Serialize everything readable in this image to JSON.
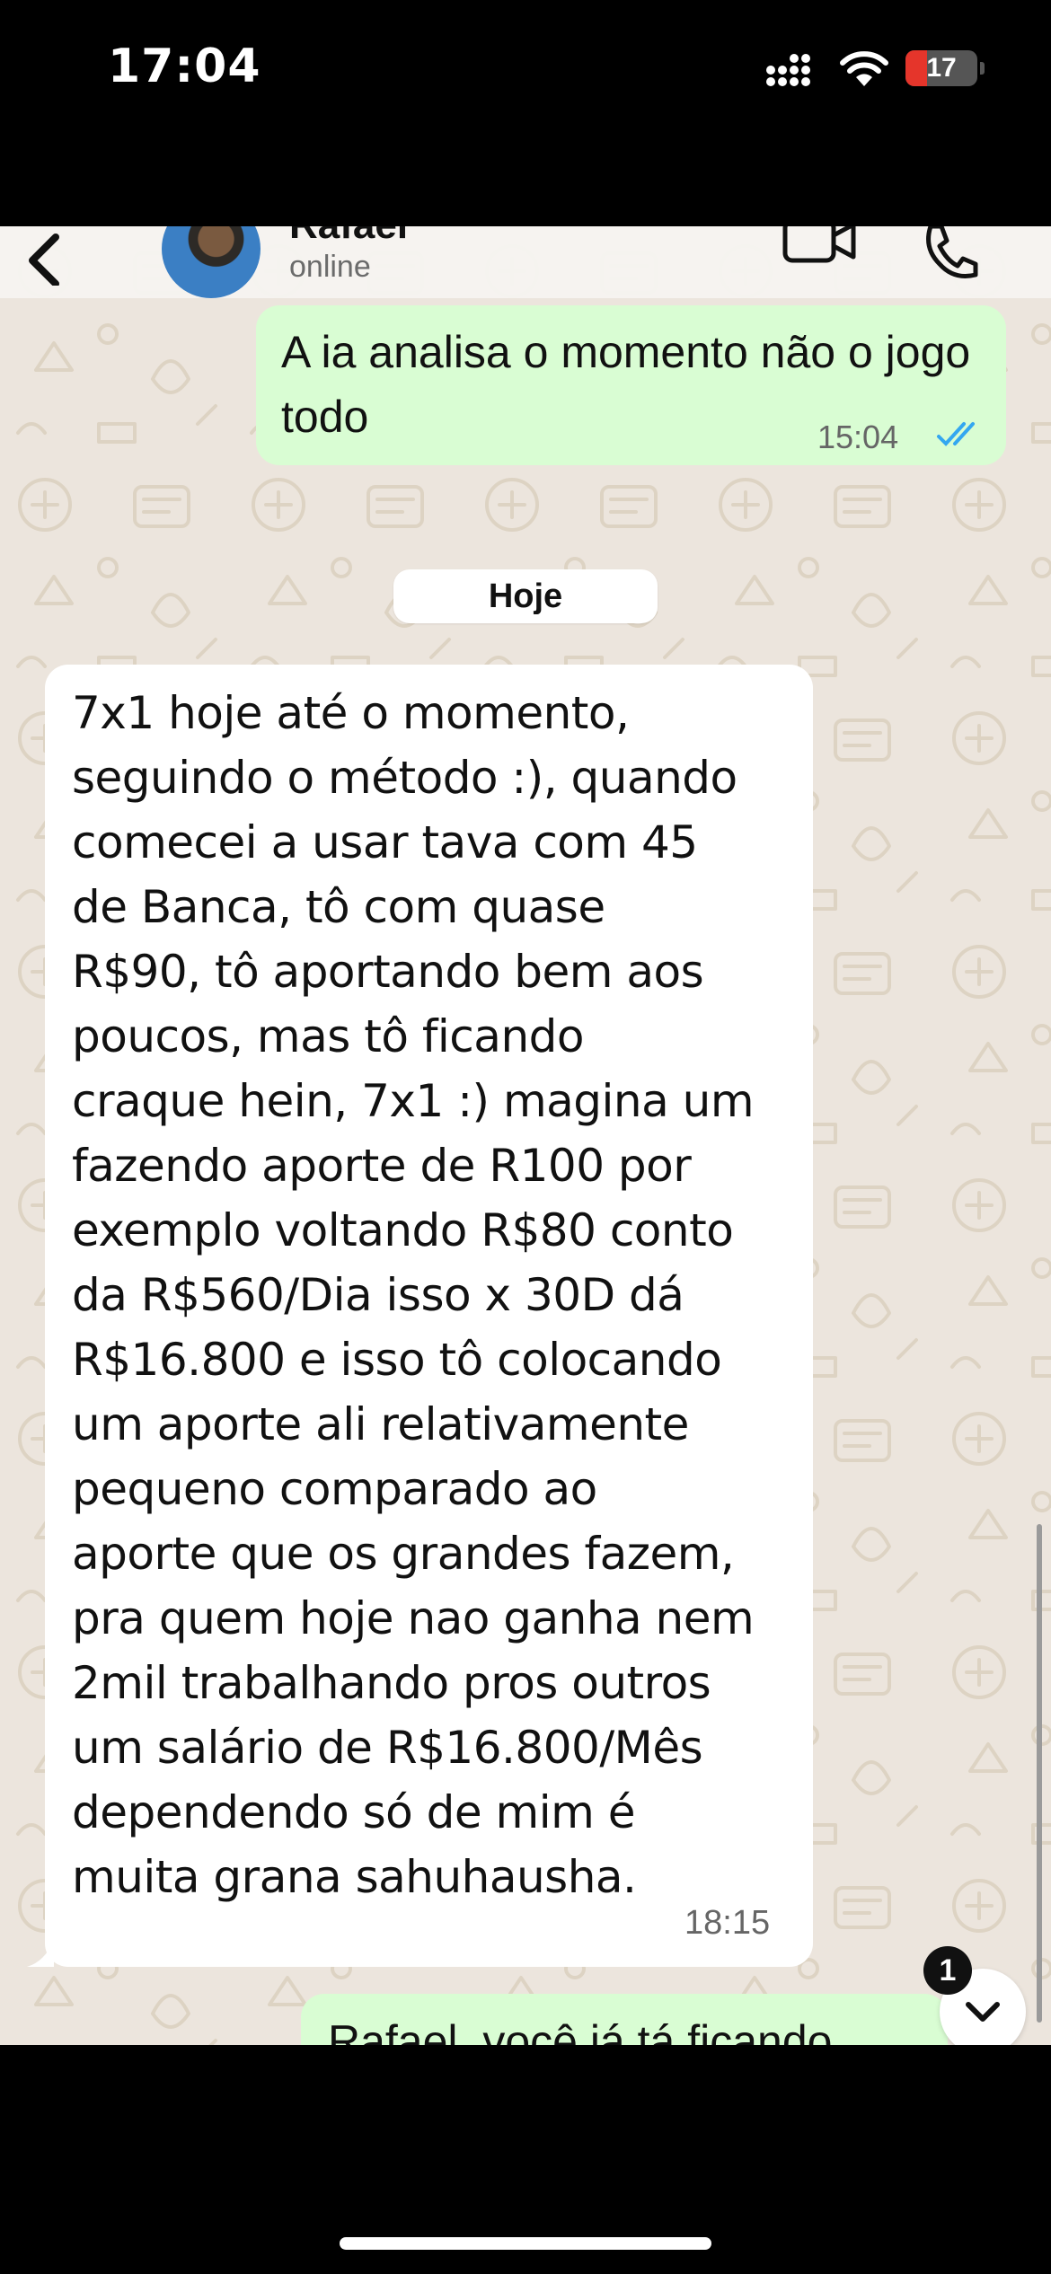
{
  "status_bar": {
    "time": "17:04",
    "battery_level": "17",
    "icons": [
      "cellular-signal-icon",
      "wifi-icon",
      "battery-icon"
    ]
  },
  "header": {
    "contact_name": "Rafael",
    "status": "online",
    "icons": [
      "back-chevron-icon",
      "video-call-icon",
      "phone-call-icon"
    ]
  },
  "messages": [
    {
      "direction": "outgoing",
      "text": "A ia analisa o momento não o jogo todo",
      "time": "15:04",
      "read_receipt": "double-check-blue"
    },
    {
      "direction": "incoming",
      "text": "7x1 hoje até o momento,\nseguindo o método :), quando\ncomecei a usar tava com 45\nde Banca, tô com quase\nR$90, tô aportando bem aos\npoucos, mas tô ficando\ncraque hein, 7x1 :) magina um\nfazendo aporte de R100 por\nexemplo voltando R$80 conto\nda R$560/Dia isso x 30D dá\nR$16.800 e isso tô colocando\num aporte ali relativamente\npequeno comparado ao\naporte que os grandes fazem,\npra quem hoje nao ganha nem\n2mil trabalhando pros outros\num salário de R$16.800/Mês\ndependendo só de mim é\nmuita grana sahuhausha.",
      "time": "18:15"
    },
    {
      "direction": "outgoing",
      "text": "Rafael, você já tá ficando",
      "partially_visible": true
    }
  ],
  "date_separator": "Hoje",
  "scroll_down": {
    "unread_count": "1",
    "icon": "chevron-down-icon"
  },
  "colors": {
    "outgoing_bubble": "#d9fdd3",
    "incoming_bubble": "#ffffff",
    "chat_background": "#ece5dd",
    "read_tick": "#34a7f0"
  }
}
